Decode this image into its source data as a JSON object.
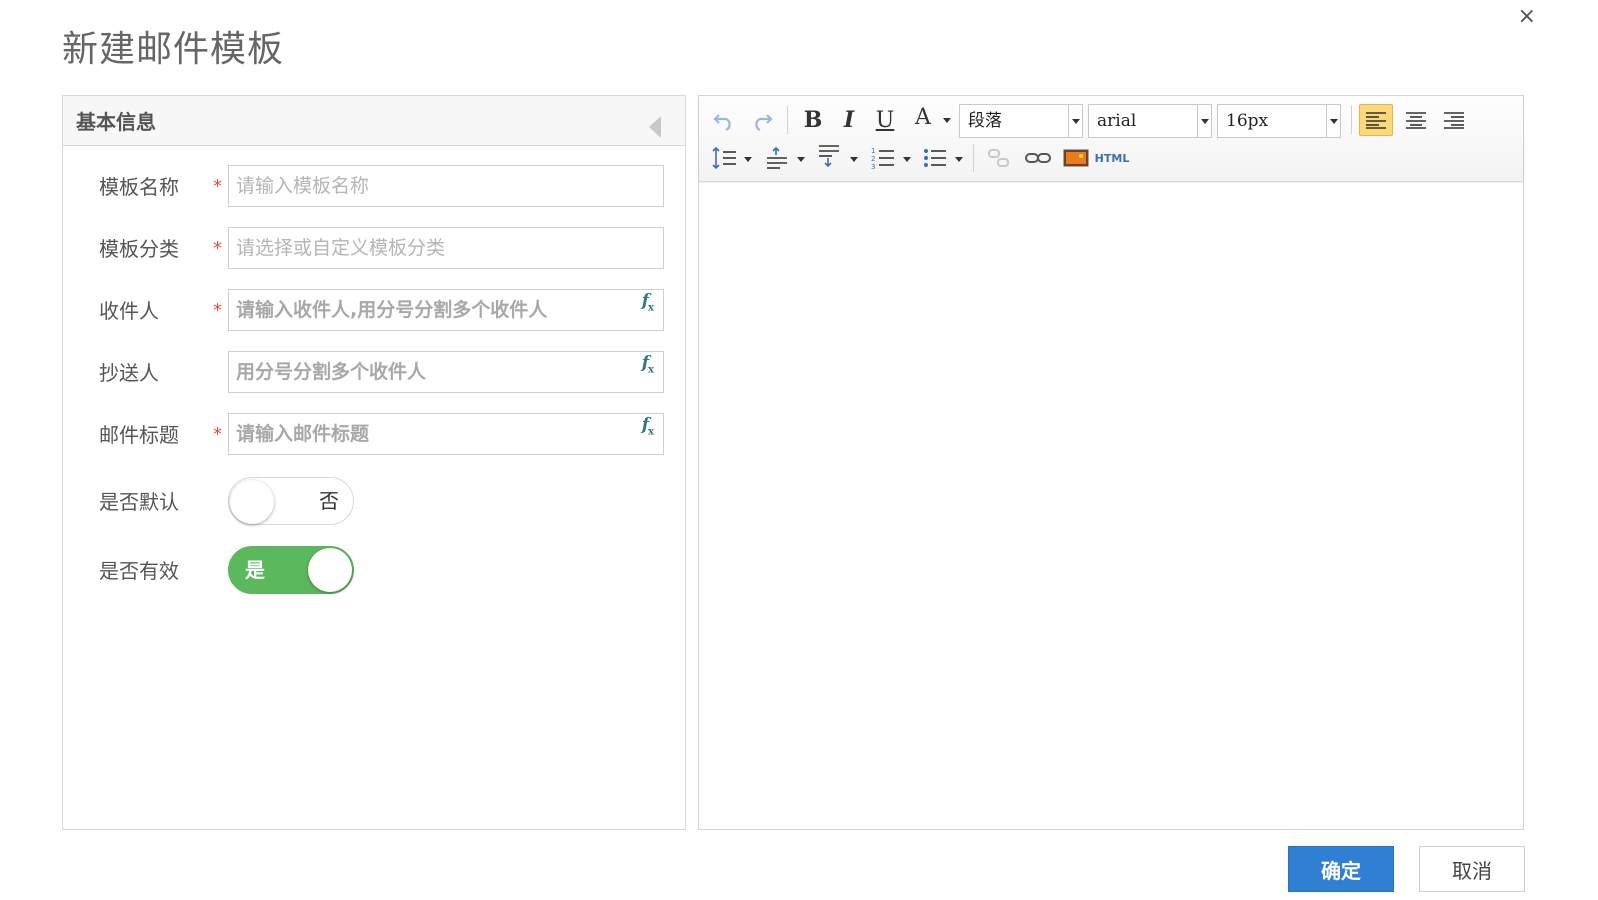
{
  "dialog": {
    "title": "新建邮件模板",
    "close_symbol": "×"
  },
  "left_panel": {
    "header": "基本信息",
    "fields": [
      {
        "label": "模板名称",
        "required": true,
        "placeholder": "请输入模板名称",
        "has_fx": false
      },
      {
        "label": "模板分类",
        "required": true,
        "placeholder": "请选择或自定义模板分类",
        "has_fx": false
      },
      {
        "label": "收件人",
        "required": true,
        "placeholder": "请输入收件人,用分号分割多个收件人",
        "has_fx": true
      },
      {
        "label": "抄送人",
        "required": false,
        "placeholder": "用分号分割多个收件人",
        "has_fx": true
      },
      {
        "label": "邮件标题",
        "required": true,
        "placeholder": "请输入邮件标题",
        "has_fx": true
      }
    ],
    "required_mark": "*",
    "toggles": [
      {
        "label": "是否默认",
        "state": "off",
        "text": "否"
      },
      {
        "label": "是否有效",
        "state": "on",
        "text": "是"
      }
    ]
  },
  "editor": {
    "toolbar": {
      "paragraph_select": "段落",
      "font_select": "arial",
      "size_select": "16px",
      "html_button": "HTML",
      "bold": "B",
      "italic": "I",
      "underline": "U",
      "font_color": "A"
    }
  },
  "footer": {
    "ok_label": "确定",
    "cancel_label": "取消"
  },
  "colors": {
    "primary": "#2f7fd3",
    "toggle_on": "#5cb85c",
    "required": "#e74c3c",
    "fx_icon": "#2e7d7a"
  }
}
